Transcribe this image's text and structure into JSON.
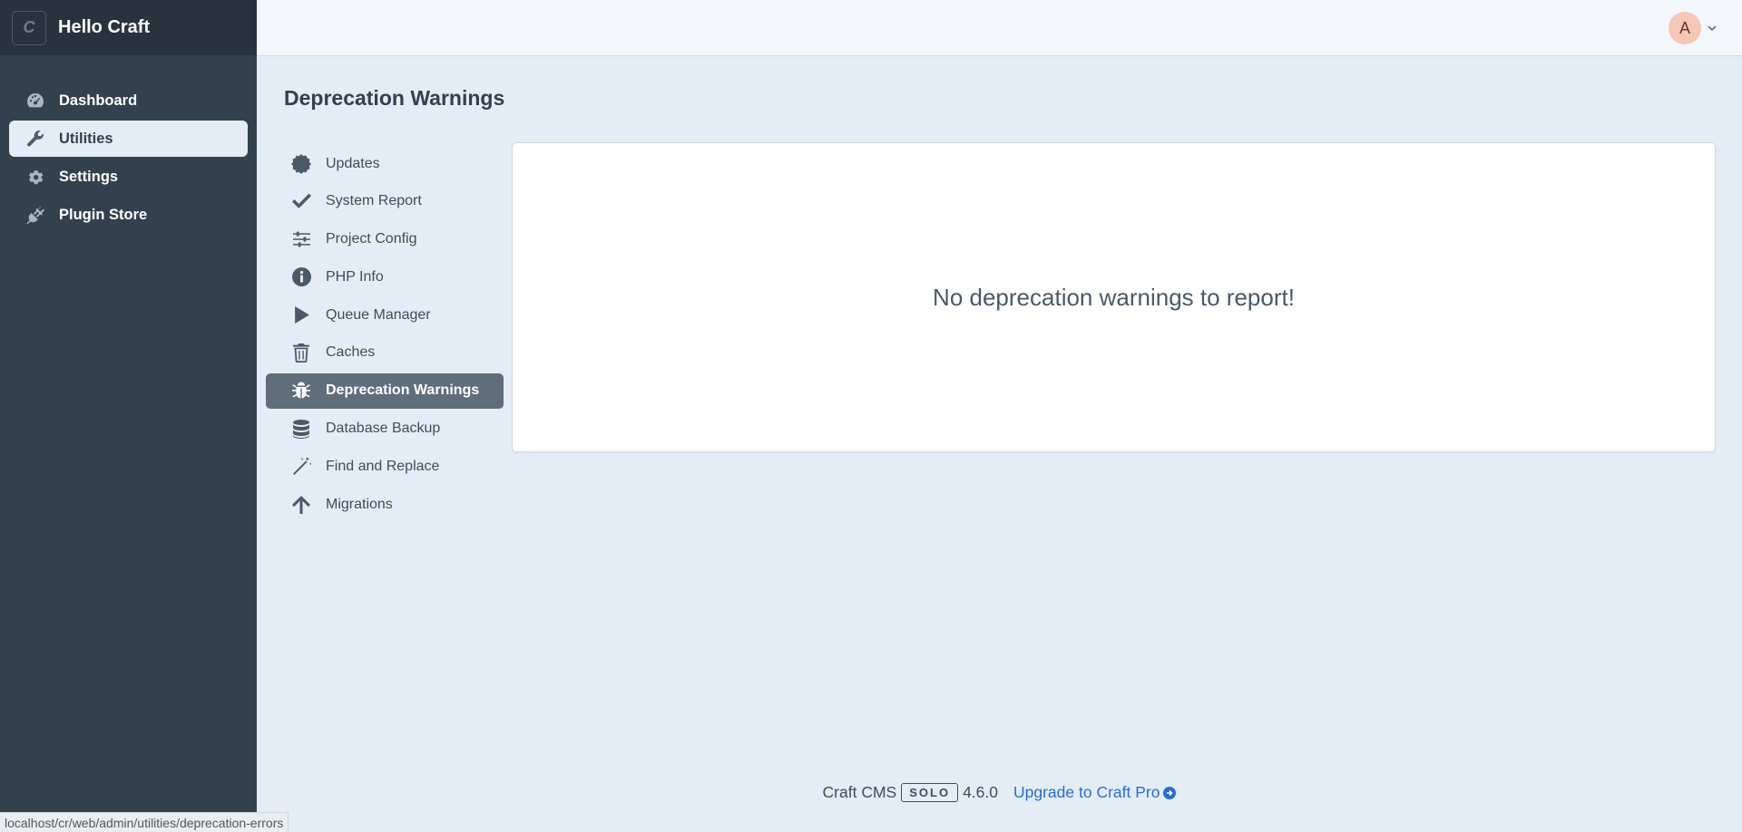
{
  "brand": {
    "logo_letter": "C",
    "site_name": "Hello Craft"
  },
  "global_nav": [
    {
      "label": "Dashboard",
      "icon": "dashboard-gauge-icon",
      "active": false
    },
    {
      "label": "Utilities",
      "icon": "wrench-icon",
      "active": true
    },
    {
      "label": "Settings",
      "icon": "gear-icon",
      "active": false
    },
    {
      "label": "Plugin Store",
      "icon": "plug-icon",
      "active": false
    }
  ],
  "header": {
    "avatar_initial": "A"
  },
  "page": {
    "title": "Deprecation Warnings"
  },
  "utilities_nav": [
    {
      "label": "Updates",
      "icon": "badge-icon",
      "active": false
    },
    {
      "label": "System Report",
      "icon": "check-icon",
      "active": false
    },
    {
      "label": "Project Config",
      "icon": "sliders-icon",
      "active": false
    },
    {
      "label": "PHP Info",
      "icon": "info-icon",
      "active": false
    },
    {
      "label": "Queue Manager",
      "icon": "play-icon",
      "active": false
    },
    {
      "label": "Caches",
      "icon": "trash-icon",
      "active": false
    },
    {
      "label": "Deprecation Warnings",
      "icon": "bug-icon",
      "active": true
    },
    {
      "label": "Database Backup",
      "icon": "database-icon",
      "active": false
    },
    {
      "label": "Find and Replace",
      "icon": "magic-wand-icon",
      "active": false
    },
    {
      "label": "Migrations",
      "icon": "arrow-up-icon",
      "active": false
    }
  ],
  "content": {
    "empty_message": "No deprecation warnings to report!"
  },
  "footer": {
    "product": "Craft CMS",
    "edition": "SOLO",
    "version": "4.6.0",
    "upgrade_label": "Upgrade to Craft Pro"
  },
  "status_bar": {
    "url": "localhost/cr/web/admin/utilities/deprecation-errors"
  },
  "colors": {
    "sidebar": "#33404d",
    "brand_bar": "#29333d",
    "page_bg": "#e4edf6",
    "active_util": "#606d7b",
    "link": "#2b6bd6"
  }
}
